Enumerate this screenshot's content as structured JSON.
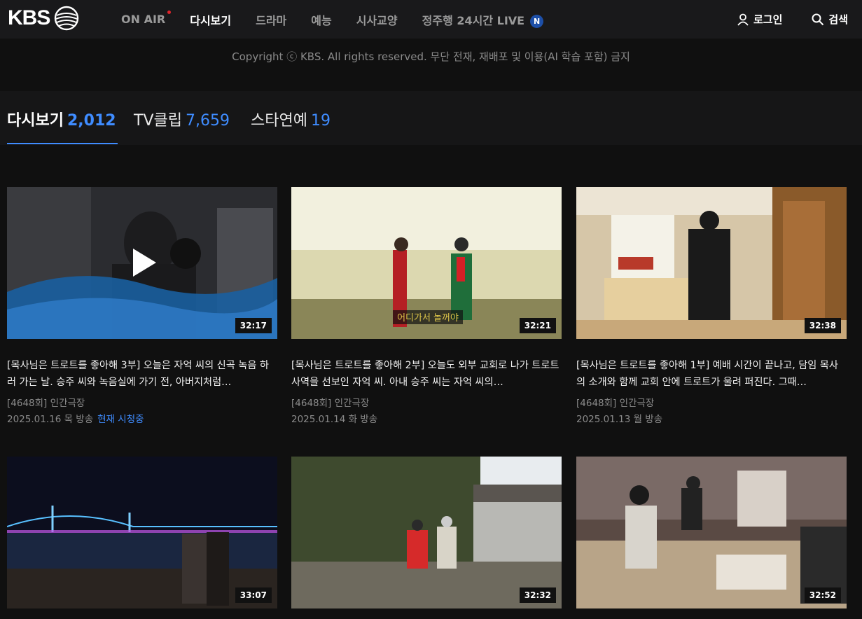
{
  "header": {
    "logo": "KBS",
    "menu": [
      {
        "label": "ON AIR"
      },
      {
        "label": "다시보기"
      },
      {
        "label": "드라마"
      },
      {
        "label": "예능"
      },
      {
        "label": "시사교양"
      },
      {
        "label": "정주행 24시간 LIVE"
      }
    ],
    "live_badge": "N",
    "login_label": "로그인",
    "search_label": "검색"
  },
  "copyright": "Copyright ⓒ KBS. All rights reserved. 무단 전재, 재배포 및 이용(AI 학습 포함) 금지",
  "tabs": [
    {
      "label": "다시보기",
      "count": "2,012"
    },
    {
      "label": "TV클립",
      "count": "7,659"
    },
    {
      "label": "스타연예",
      "count": "19"
    }
  ],
  "cards": [
    {
      "duration": "32:17",
      "title": "[목사님은 트로트를 좋아해 3부] 오늘은 자억 씨의 신곡 녹음 하러 가는 날. 승주 씨와 녹음실에 가기 전, 아버지처럼…",
      "program": "[4648회] 인간극장",
      "date": "2025.01.16 목 방송",
      "status": "현재 시청중"
    },
    {
      "duration": "32:21",
      "caption": "어디가서 놀꺼야",
      "title": "[목사님은 트로트를 좋아해 2부] 오늘도 외부 교회로 나가 트로트 사역을 선보인 자억 씨. 아내 승주 씨는 자억 씨의…",
      "program": "[4648회] 인간극장",
      "date": "2025.01.14 화 방송"
    },
    {
      "duration": "32:38",
      "title": "[목사님은 트로트를 좋아해 1부] 예배 시간이 끝나고, 담임 목사의 소개와 함께 교회 안에 트로트가 울려 퍼진다. 그때…",
      "program": "[4648회] 인간극장",
      "date": "2025.01.13 월 방송"
    },
    {
      "duration": "33:07"
    },
    {
      "duration": "32:32"
    },
    {
      "duration": "32:52"
    }
  ],
  "colors": {
    "accent": "#3f8cff",
    "background": "#101010",
    "onair_dot": "#e0242b"
  }
}
